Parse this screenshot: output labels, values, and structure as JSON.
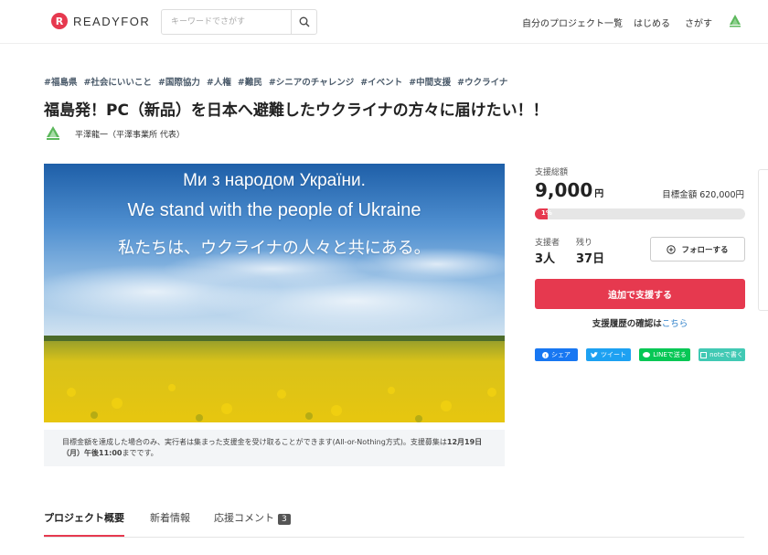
{
  "header": {
    "logo_mark": "R",
    "logo_text": "READYFOR",
    "search_placeholder": "キーワードでさがす",
    "nav": [
      "自分のプロジェクト一覧",
      "はじめる",
      "さがす"
    ]
  },
  "project": {
    "tags": [
      "#福島県",
      "#社会にいいこと",
      "#国際協力",
      "#人権",
      "#難民",
      "#シニアのチャレンジ",
      "#イベント",
      "#中間支援",
      "#ウクライナ"
    ],
    "title": "福島発！PC（新品）を日本へ避難したウクライナの方々に届けたい！！",
    "owner": "平澤龍一（平澤事業所 代表）",
    "hero_lines": [
      "Ми з народом України.",
      "We stand with the people of Ukraine",
      "私たちは、ウクライナの人々と共にある。"
    ],
    "notice_text": "目標金額を達成した場合のみ、実行者は集まった支援金を受け取ることができます(All-or-Nothing方式)。支援募集は",
    "notice_bold": "12月19日（月）午後11:00",
    "notice_end": "までです。"
  },
  "tabs": {
    "overview": "プロジェクト概要",
    "news": "新着情報",
    "comments": "応援コメント",
    "comments_count": "3"
  },
  "funding": {
    "total_label": "支援総額",
    "total_value": "9,000",
    "total_unit": "円",
    "goal_text": "目標金額 620,000円",
    "progress_label": "1%",
    "progress_fraction": 0.0145,
    "supporters_label": "支援者",
    "supporters_value": "3人",
    "remaining_label": "残り",
    "remaining_value": "37日",
    "follow_label": "フォローする",
    "support_button": "追加で支援する",
    "history_text": "支援履歴の確認は",
    "history_link": "こちら"
  },
  "share": {
    "facebook": "シェア",
    "twitter": "ツイート",
    "line": "LINEで送る",
    "note": "noteで書く"
  },
  "colors": {
    "accent": "#e6394f",
    "link": "#2a7ec9",
    "facebook": "#1877f2",
    "twitter": "#1da1f2",
    "line": "#06c755",
    "note": "#41c9b4"
  }
}
